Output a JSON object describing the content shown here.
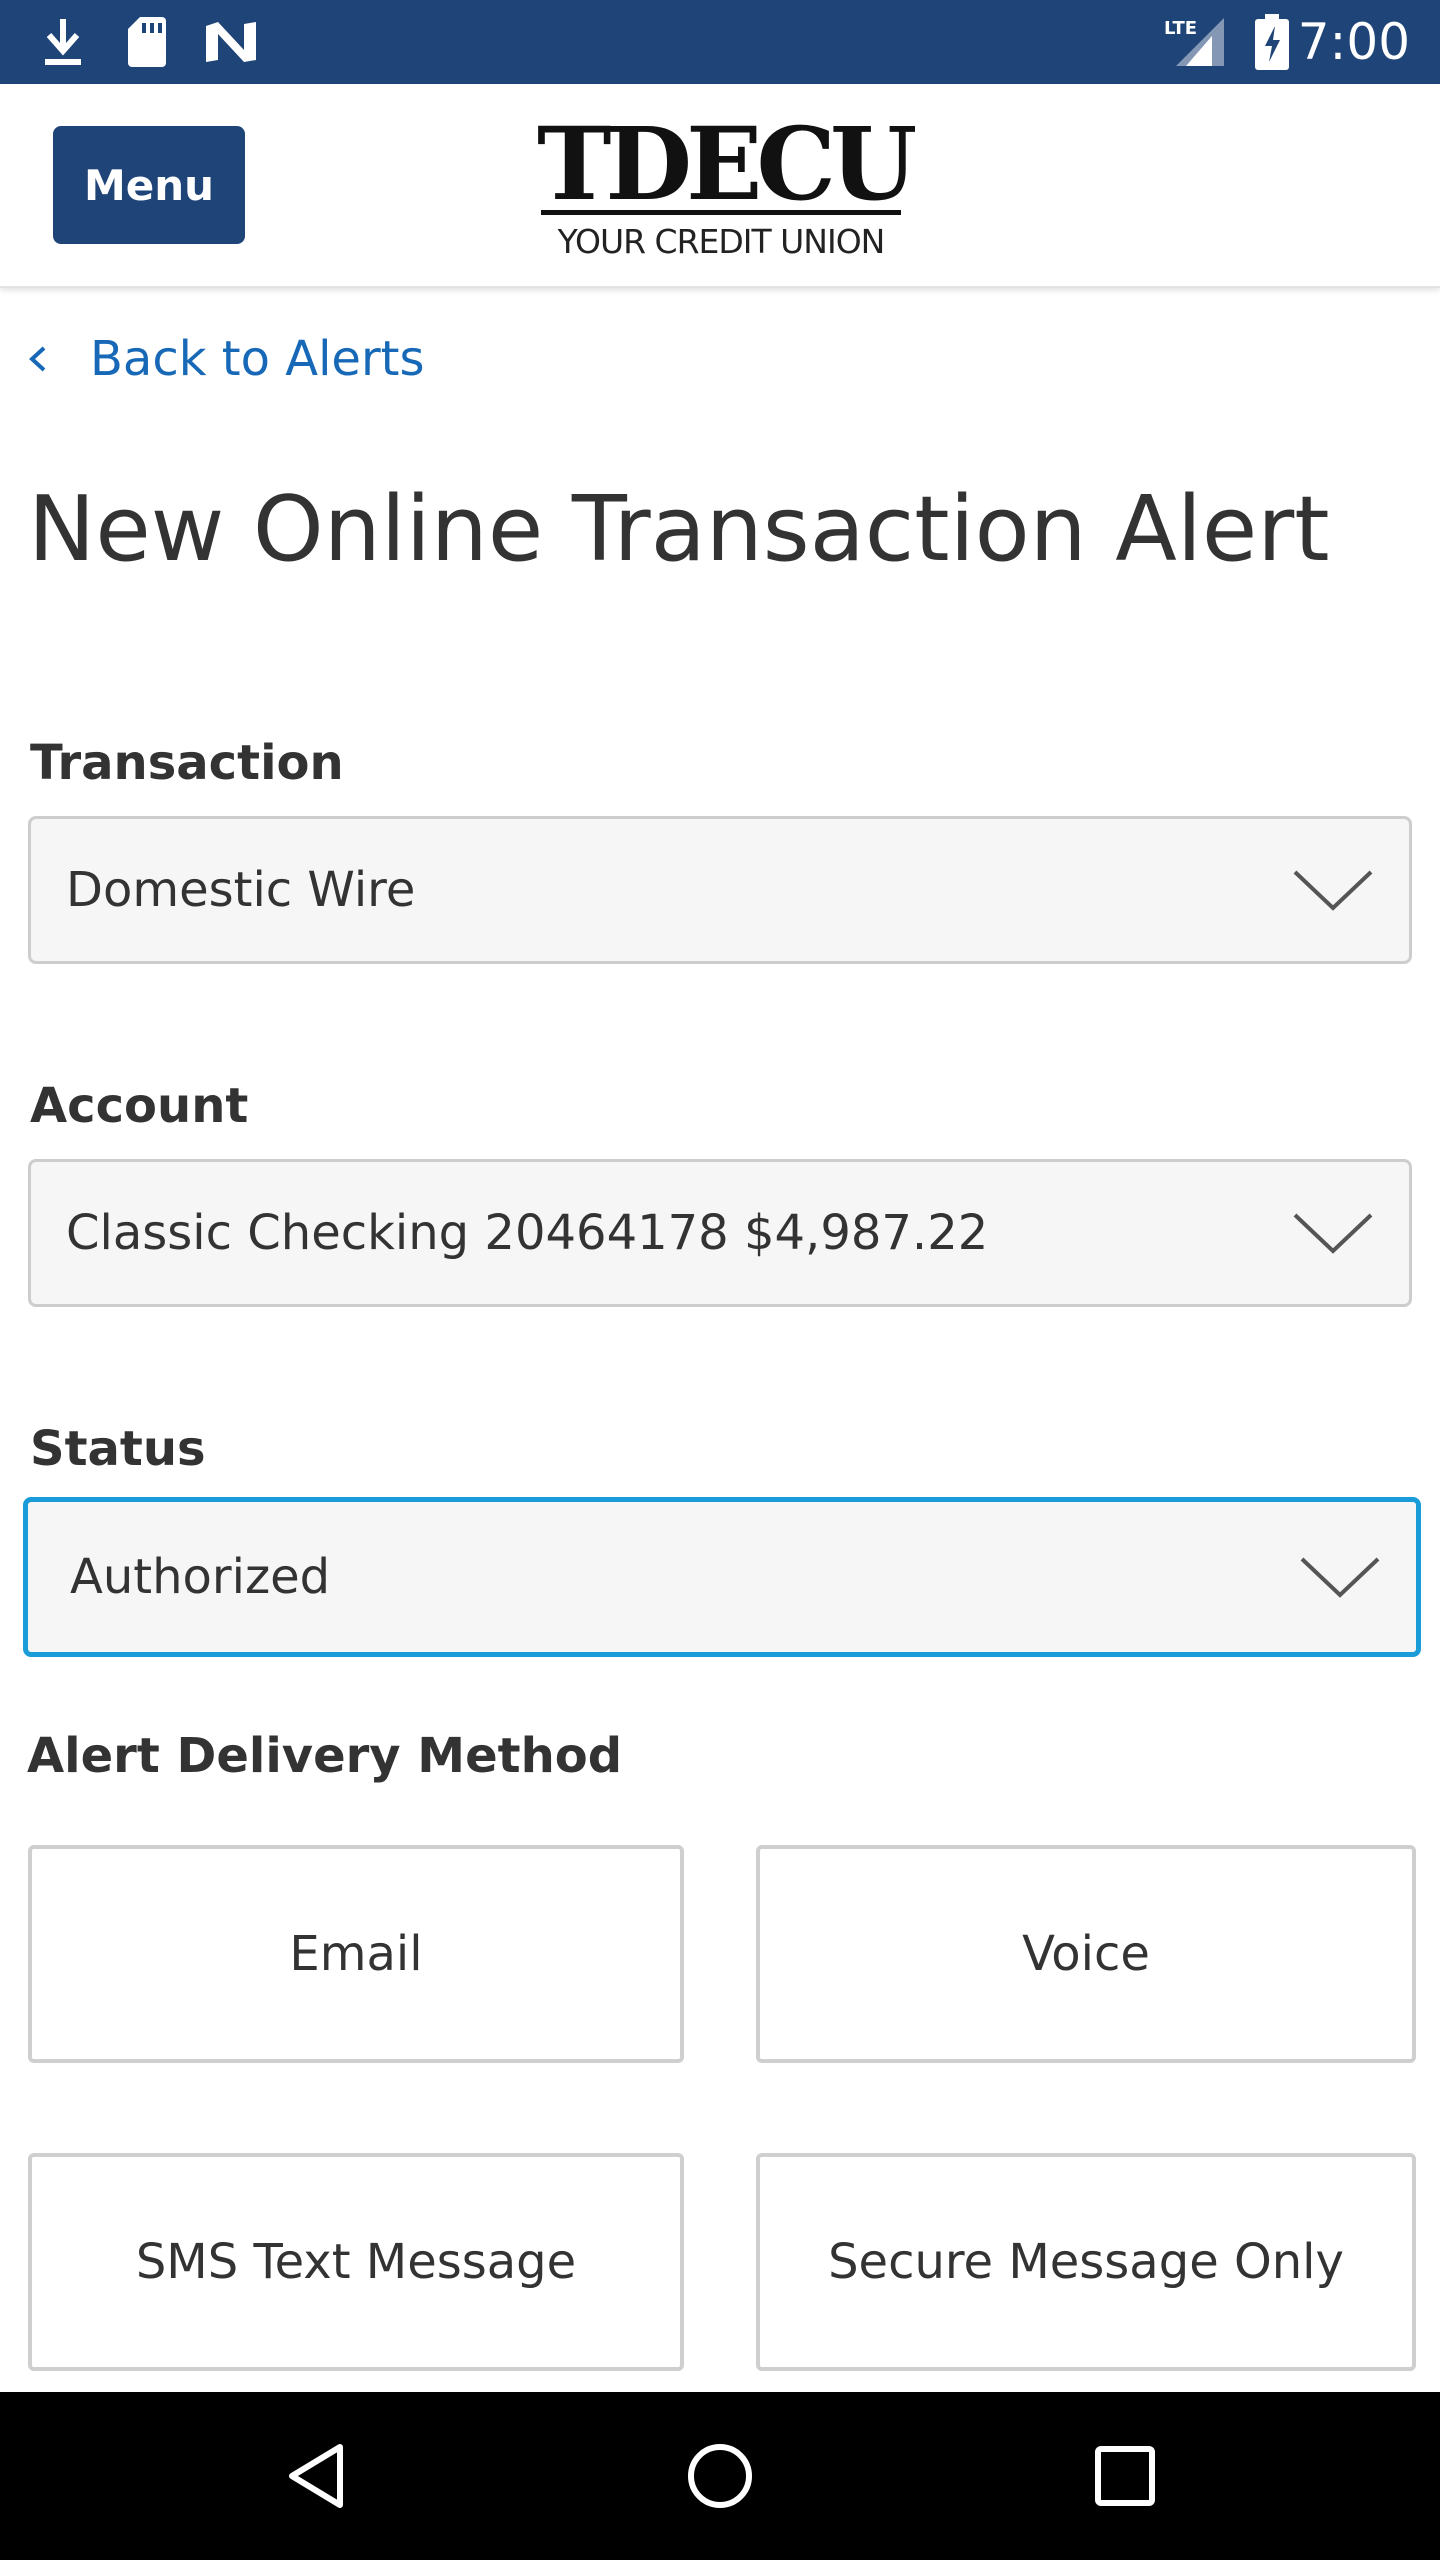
{
  "status_bar": {
    "time": "7:00",
    "icons": [
      "download-icon",
      "sd-card-icon",
      "n-notification-icon",
      "lte-signal-icon",
      "battery-charging-icon"
    ],
    "network_label": "LTE",
    "background": "#1f4478"
  },
  "header": {
    "menu_label": "Menu",
    "logo_text": "TDECU",
    "logo_subtitle": "YOUR CREDIT UNION",
    "accent": "#1f4478"
  },
  "back_link": {
    "label": "Back to Alerts",
    "icon": "chevron-left-icon",
    "color": "#1768b7"
  },
  "page": {
    "title": "New Online Transaction Alert"
  },
  "form": {
    "transaction": {
      "label": "Transaction",
      "value": "Domestic Wire"
    },
    "account": {
      "label": "Account",
      "value": "Classic Checking 20464178 $4,987.22"
    },
    "status": {
      "label": "Status",
      "value": "Authorized",
      "focused": true,
      "focus_color": "#1a9cd8"
    },
    "delivery": {
      "label": "Alert Delivery Method",
      "options": [
        "Email",
        "Voice",
        "SMS Text Message",
        "Secure Message Only"
      ]
    }
  },
  "nav_bar": {
    "icons": [
      "back-triangle-icon",
      "home-circle-icon",
      "recents-square-icon"
    ]
  }
}
